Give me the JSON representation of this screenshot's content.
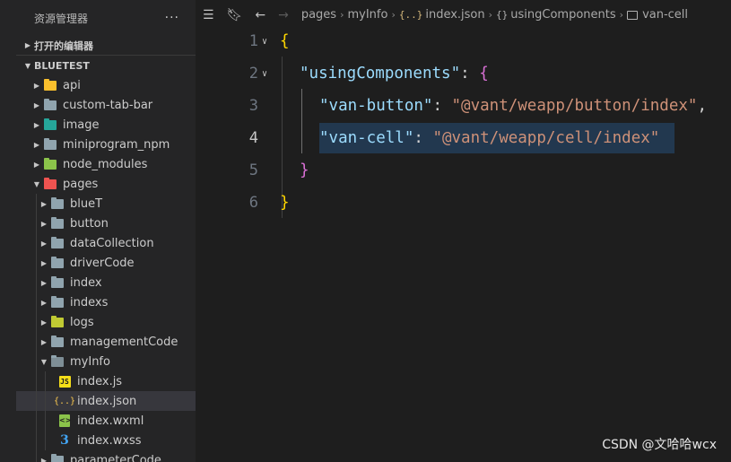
{
  "sidebar": {
    "title": "资源管理器",
    "more": "···",
    "open_editors": "打开的编辑器",
    "project": "BLUETEST",
    "items": [
      {
        "label": "api",
        "icon": "api-folder-icon"
      },
      {
        "label": "custom-tab-bar",
        "icon": "folder-icon"
      },
      {
        "label": "image",
        "icon": "image-folder-icon"
      },
      {
        "label": "miniprogram_npm",
        "icon": "folder-icon"
      },
      {
        "label": "node_modules",
        "icon": "node-folder-icon"
      },
      {
        "label": "pages",
        "icon": "pages-folder-icon"
      },
      {
        "label": "blueT",
        "icon": "folder-icon"
      },
      {
        "label": "button",
        "icon": "folder-icon"
      },
      {
        "label": "dataCollection",
        "icon": "folder-icon"
      },
      {
        "label": "driverCode",
        "icon": "folder-icon"
      },
      {
        "label": "index",
        "icon": "folder-icon"
      },
      {
        "label": "indexs",
        "icon": "folder-icon"
      },
      {
        "label": "logs",
        "icon": "logs-folder-icon"
      },
      {
        "label": "managementCode",
        "icon": "folder-icon"
      },
      {
        "label": "myInfo",
        "icon": "folder-open-icon"
      },
      {
        "label": "index.js",
        "icon": "js-file-icon"
      },
      {
        "label": "index.json",
        "icon": "json-file-icon"
      },
      {
        "label": "index.wxml",
        "icon": "wxml-file-icon"
      },
      {
        "label": "index.wxss",
        "icon": "wxss-file-icon"
      },
      {
        "label": "parameterCode",
        "icon": "folder-icon"
      }
    ]
  },
  "breadcrumb": {
    "items": [
      "pages",
      "myInfo",
      "index.json",
      "usingComponents",
      "van-cell"
    ]
  },
  "code": {
    "line_numbers": [
      "1",
      "2",
      "3",
      "4",
      "5",
      "6"
    ],
    "open_brace": "{",
    "close_brace": "}",
    "key_using": "\"usingComponents\"",
    "colon": ": ",
    "key_button": "\"van-button\"",
    "val_button": "\"@vant/weapp/button/index\"",
    "comma": ",",
    "key_cell": "\"van-cell\"",
    "val_cell": "\"@vant/weapp/cell/index\""
  },
  "watermark": "CSDN @文哈哈wcx",
  "colors": {
    "background": "#1e1e1e",
    "sidebar": "#252526",
    "key": "#9cdcfe",
    "string": "#ce9178",
    "brace_level1": "#ffd700",
    "brace_level2": "#da70d6",
    "selection": "#264f78"
  }
}
